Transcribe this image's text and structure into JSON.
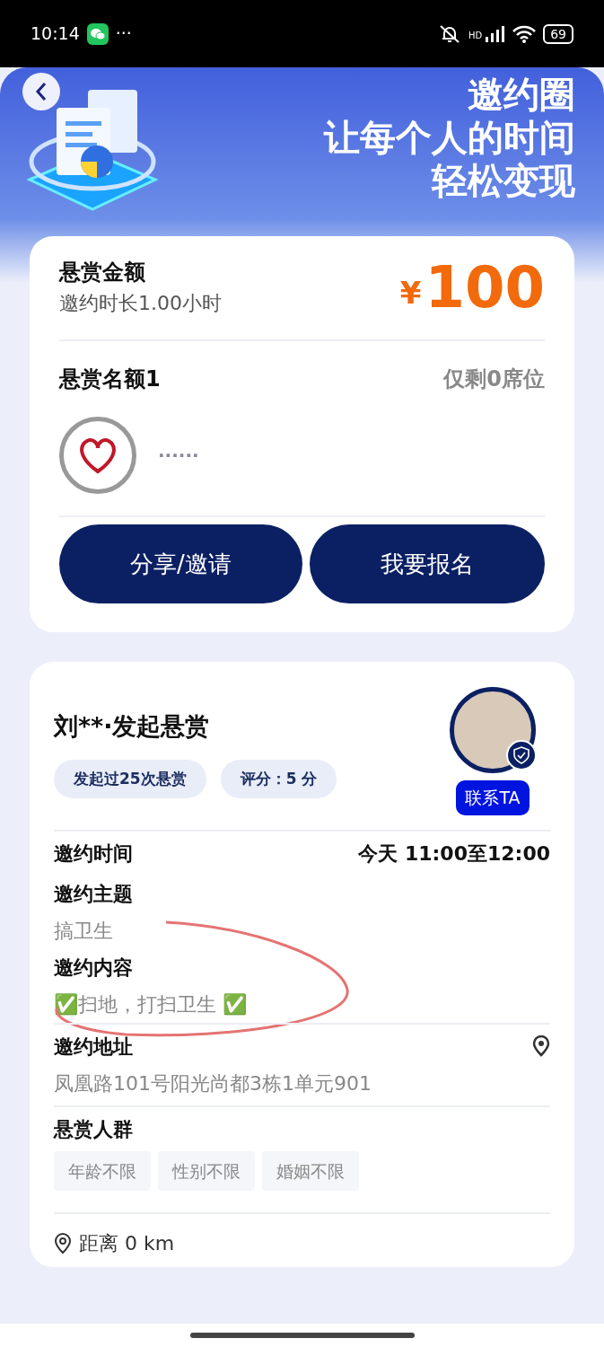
{
  "status_bar": {
    "time": "10:14",
    "more": "···",
    "network": "HD",
    "battery": "69"
  },
  "banner": {
    "title": "邀约圈",
    "slogan_lines": [
      "让每个人的时间",
      "轻松变现"
    ]
  },
  "reward": {
    "label": "悬赏金额",
    "duration": "邀约时长1.00小时",
    "currency": "¥",
    "amount": "100",
    "quota_label": "悬赏名额1",
    "seats_left": "仅剩0席位",
    "participant_name": "······"
  },
  "actions": [
    {
      "label": "分享/邀请"
    },
    {
      "label": "我要报名"
    }
  ],
  "publisher": {
    "title": "刘**·发起悬赏",
    "tags": [
      "发起过25次悬赏",
      "评分：5 分"
    ],
    "verified": true,
    "contact": "联系TA"
  },
  "details": [
    {
      "kind": "inline",
      "label": "邀约时间",
      "value": "今天 11:00至12:00"
    },
    {
      "kind": "block",
      "label": "邀约主题",
      "value": "搞卫生"
    },
    {
      "kind": "block",
      "label": "邀约内容",
      "value": "✅扫地，打扫卫生 ✅",
      "annotated": true
    },
    {
      "kind": "location",
      "label": "邀约地址",
      "value": "凤凰路101号阳光尚都3栋1单元901"
    },
    {
      "kind": "tags",
      "label": "悬赏人群",
      "tags": [
        "年龄不限",
        "性别不限",
        "婚姻不限"
      ]
    }
  ],
  "distance": "距离 0 km"
}
